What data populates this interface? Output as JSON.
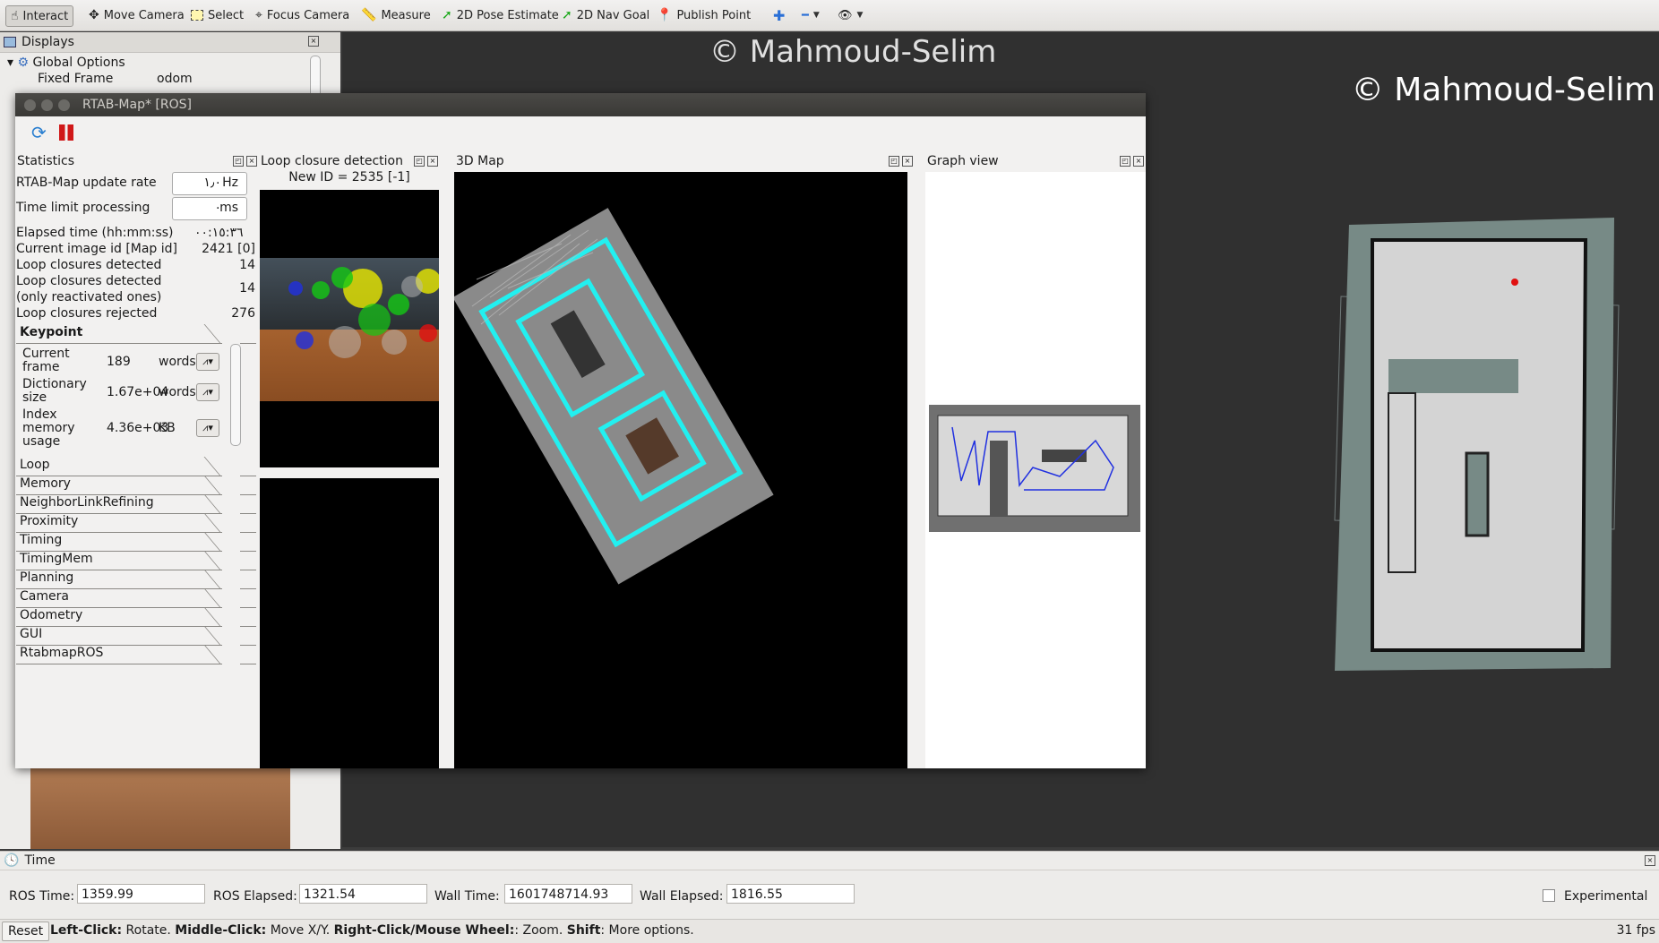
{
  "toolbar": {
    "interact": "Interact",
    "move_camera": "Move Camera",
    "select": "Select",
    "focus_camera": "Focus Camera",
    "measure": "Measure",
    "pose_estimate": "2D Pose Estimate",
    "nav_goal": "2D Nav Goal",
    "publish_point": "Publish Point"
  },
  "displays": {
    "title": "Displays",
    "global_options": "Global Options",
    "fixed_frame_label": "Fixed Frame",
    "fixed_frame_value": "odom"
  },
  "watermark": "© Mahmoud-Selim",
  "rtab": {
    "title": "RTAB-Map* [ROS]",
    "statistics": {
      "title": "Statistics",
      "update_rate_label": "RTAB-Map update rate",
      "update_rate_value": "١٫٠",
      "update_rate_unit": "Hz",
      "time_limit_label": "Time limit processing",
      "time_limit_value": "٠",
      "time_limit_unit": "ms",
      "elapsed_label": "Elapsed time (hh:mm:ss)",
      "elapsed_value": "٠٠:١٥:٣٦",
      "image_id_label": "Current image id [Map id]",
      "image_id_value": "2421 [0]",
      "loop_detected_label": "Loop closures detected",
      "loop_detected_value": "14",
      "loop_react_label_1": "Loop closures detected",
      "loop_react_label_2": "(only reactivated ones)",
      "loop_react_value": "14",
      "loop_rejected_label": "Loop closures rejected",
      "loop_rejected_value": "276",
      "keypoint_title": "Keypoint",
      "keypoint_rows": [
        {
          "label": [
            "Current",
            "frame"
          ],
          "value": "189",
          "unit": "words"
        },
        {
          "label": [
            "Dictionary",
            "size"
          ],
          "value": "1.67e+04",
          "unit": "words"
        },
        {
          "label": [
            "Index",
            "memory",
            "usage"
          ],
          "value": "4.36e+03",
          "unit": "KB"
        }
      ],
      "sections": [
        "Loop",
        "Memory",
        "NeighborLinkRefining",
        "Proximity",
        "Timing",
        "TimingMem",
        "Planning",
        "Camera",
        "Odometry",
        "GUI",
        "RtabmapROS"
      ]
    },
    "loop_closure": {
      "title": "Loop closure detection",
      "new_id": "New ID = 2535 [-1]"
    },
    "map3d": {
      "title": "3D Map"
    },
    "graph": {
      "title": "Graph view"
    }
  },
  "time": {
    "title": "Time",
    "ros_time_label": "ROS Time:",
    "ros_time": "1359.99",
    "ros_elapsed_label": "ROS Elapsed:",
    "ros_elapsed": "1321.54",
    "wall_time_label": "Wall Time:",
    "wall_time": "1601748714.93",
    "wall_elapsed_label": "Wall Elapsed:",
    "wall_elapsed": "1816.55",
    "experimental": "Experimental"
  },
  "status": {
    "reset": "Reset",
    "left": "Left-Click:",
    "left_t": " Rotate. ",
    "middle": "Middle-Click:",
    "middle_t": " Move X/Y. ",
    "right": "Right-Click/Mouse Wheel:",
    "right_t": ": Zoom. ",
    "shift": "Shift",
    "shift_t": ": More options.",
    "fps": "31 fps"
  }
}
